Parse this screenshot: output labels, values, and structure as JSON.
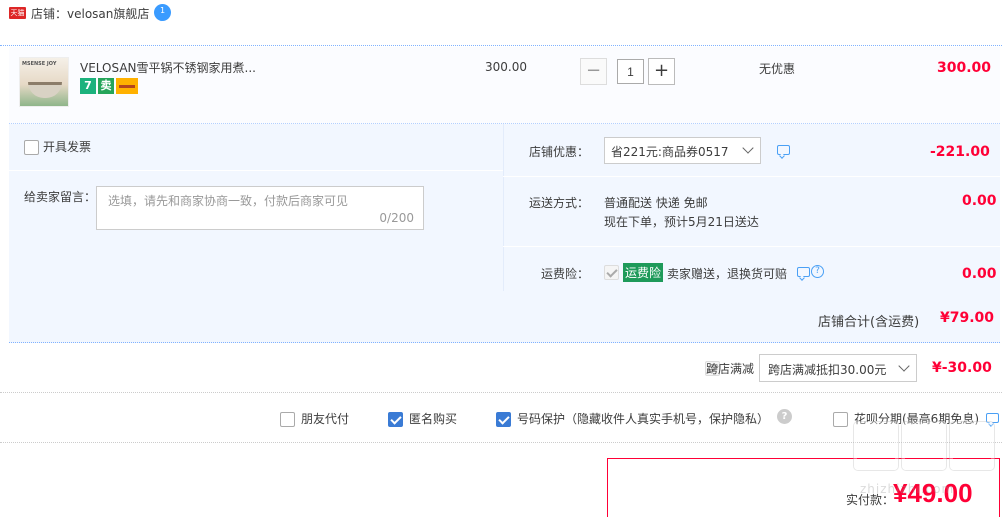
{
  "shop": {
    "badge": "天猫",
    "label": "店铺：velosan旗舰店",
    "ww": "1"
  },
  "item": {
    "thumb_text": "MSENSE JOY",
    "title": "VELOSAN雪平锅不锈钢家用煮...",
    "services": [
      "7",
      "卖"
    ],
    "unit_price": "300.00",
    "qty": "1",
    "qty_minus": "−",
    "qty_plus": "+",
    "discount": "无优惠",
    "total": "300.00"
  },
  "invoice": {
    "label": "开具发票"
  },
  "message": {
    "label": "给卖家留言：",
    "placeholder": "选填，请先和商家协商一致，付款后商家可见",
    "counter": "0/200"
  },
  "coupon": {
    "label": "店铺优惠：",
    "selected": "省221元:商品券0517",
    "amount": "-221.00"
  },
  "shipping": {
    "label": "运送方式：",
    "method": "普通配送 快递 免邮",
    "eta": "现在下单，预计5月21日送达",
    "amount": "0.00"
  },
  "insurance": {
    "label": "运费险：",
    "tag": "运费险",
    "desc": "卖家赠送，退换货可赔",
    "help": "?",
    "amount": "0.00"
  },
  "subtotal": {
    "label": "店铺合计(含运费)",
    "amount": "¥79.00"
  },
  "cross_store": {
    "label": "跨店满减",
    "selected": "跨店满减抵扣30.00元",
    "amount": "¥-30.00"
  },
  "options": {
    "friend_pay": "朋友代付",
    "anonymous": "匿名购买",
    "phone_protect": "号码保护（隐藏收件人真实手机号，保护隐私）",
    "help": "?",
    "huabei": "花呗分期(最高6期免息)"
  },
  "pay": {
    "label": "实付款：",
    "amount": "¥49.00"
  },
  "watermark": {
    "text": "zhizhizhi.com"
  },
  "colors": {
    "price_red": "#ff0036",
    "checkbox_blue": "#3a7bd5",
    "panel_bg": "#f2f7ff",
    "insurance_green": "#1e9a5a"
  }
}
